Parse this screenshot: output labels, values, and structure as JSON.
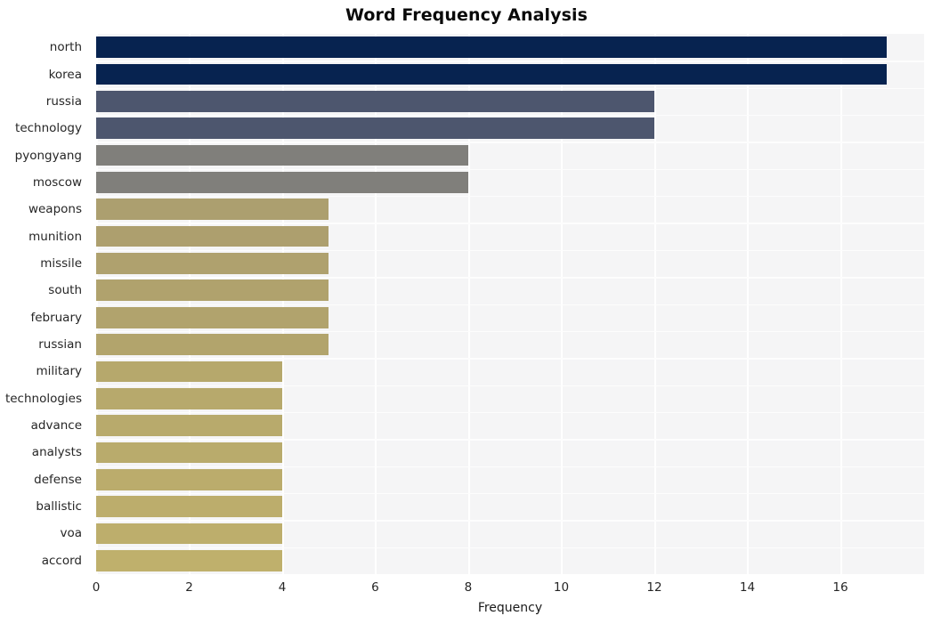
{
  "chart_data": {
    "type": "bar",
    "orientation": "horizontal",
    "title": "Word Frequency Analysis",
    "xlabel": "Frequency",
    "ylabel": "",
    "xlim": [
      0,
      17.8
    ],
    "xticks": [
      0,
      2,
      4,
      6,
      8,
      10,
      12,
      14,
      16
    ],
    "xtick_labels": [
      "0",
      "2",
      "4",
      "6",
      "8",
      "10",
      "12",
      "14",
      "16"
    ],
    "grid": true,
    "legend": null,
    "categories": [
      "north",
      "korea",
      "russia",
      "technology",
      "pyongyang",
      "moscow",
      "weapons",
      "munition",
      "missile",
      "south",
      "february",
      "russian",
      "military",
      "technologies",
      "advance",
      "analysts",
      "defense",
      "ballistic",
      "voa",
      "accord"
    ],
    "values": [
      17,
      17,
      12,
      12,
      8,
      8,
      5,
      5,
      5,
      5,
      5,
      5,
      4,
      4,
      4,
      4,
      4,
      4,
      4,
      4
    ],
    "bar_colors": [
      "#072350",
      "#072350",
      "#4d566e",
      "#4d566e",
      "#807f7b",
      "#807f7b",
      "#ac9f6f",
      "#ad9f6e",
      "#af a16e",
      "#b0a26d",
      "#b1a36d",
      "#b2a46c",
      "#b6a86c",
      "#b7a96c",
      "#b8aa6c",
      "#b9ab6c",
      "#bbac6c",
      "#bcad6c",
      "#bdae6c",
      "#bfb06c"
    ],
    "plot_background": "#f5f5f6",
    "gridline_color": "#ffffff",
    "title_color": "#0a0a0a"
  }
}
